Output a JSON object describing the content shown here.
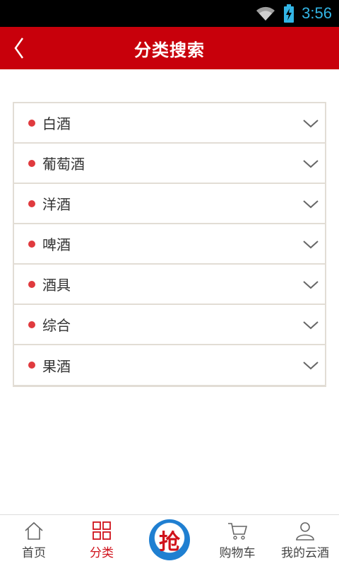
{
  "status_bar": {
    "time": "3:56",
    "icons": [
      "wifi-icon",
      "battery-charging-icon"
    ]
  },
  "header": {
    "title": "分类搜索",
    "back_icon": "chevron-left-icon"
  },
  "categories": [
    {
      "label": "白酒"
    },
    {
      "label": "葡萄酒"
    },
    {
      "label": "洋酒"
    },
    {
      "label": "啤酒"
    },
    {
      "label": "酒具"
    },
    {
      "label": "综合"
    },
    {
      "label": "果酒"
    }
  ],
  "tabbar": {
    "items": [
      {
        "label": "首页",
        "icon": "home-icon",
        "active": false
      },
      {
        "label": "分类",
        "icon": "grid-icon",
        "active": true
      },
      {
        "label": "",
        "icon": "grab-deal-icon",
        "badge_text": "抢",
        "active": false
      },
      {
        "label": "购物车",
        "icon": "cart-icon",
        "active": false
      },
      {
        "label": "我的云酒",
        "icon": "user-icon",
        "active": false
      }
    ]
  },
  "colors": {
    "brand_red": "#c8000b",
    "dot_red": "#e03a3e",
    "active_tab": "#d0121b",
    "grab_blue": "#1f7fd1"
  }
}
